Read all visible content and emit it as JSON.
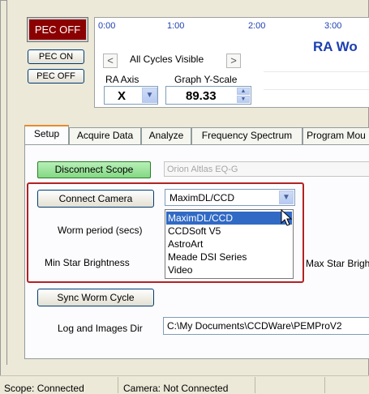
{
  "pec": {
    "status_label": "PEC OFF",
    "on_label": "PEC ON",
    "off_label": "PEC OFF"
  },
  "graph": {
    "ticks": [
      "0:00",
      "1:00",
      "2:00",
      "3:00"
    ],
    "title": "RA Wo",
    "cycles_label": "All Cycles Visible",
    "prev_arrow": "<",
    "next_arrow": ">",
    "ra_axis_label": "RA Axis",
    "ra_axis_value": "X",
    "yscale_label": "Graph Y-Scale",
    "yscale_value": "89.33"
  },
  "tabs": [
    "Setup",
    "Acquire Data",
    "Analyze",
    "Frequency Spectrum",
    "Program Mou"
  ],
  "setup": {
    "disconnect_label": "Disconnect Scope",
    "scope_name": "Orion Altlas EQ-G",
    "connect_camera_label": "Connect Camera",
    "camera_selected": "MaximDL/CCD",
    "camera_options": [
      "MaximDL/CCD",
      "CCDSoft V5",
      "AstroArt",
      "Meade DSI Series",
      "Video"
    ],
    "worm_period_label": "Worm period (secs)",
    "min_star_label": "Min Star Brightness",
    "max_star_label": "Max Star Brightn",
    "sync_label": "Sync Worm Cycle",
    "log_label": "Log and Images Dir",
    "log_path": "C:\\My Documents\\CCDWare\\PEMProV2"
  },
  "status": {
    "scope": "Scope: Connected",
    "camera": "Camera: Not Connected"
  },
  "colors": {
    "pec_status_bg": "#8b0000",
    "graph_text": "#1c3fb0",
    "selection": "#316ac5",
    "highlight_box": "#b22222",
    "connected_green": "#84d884"
  }
}
